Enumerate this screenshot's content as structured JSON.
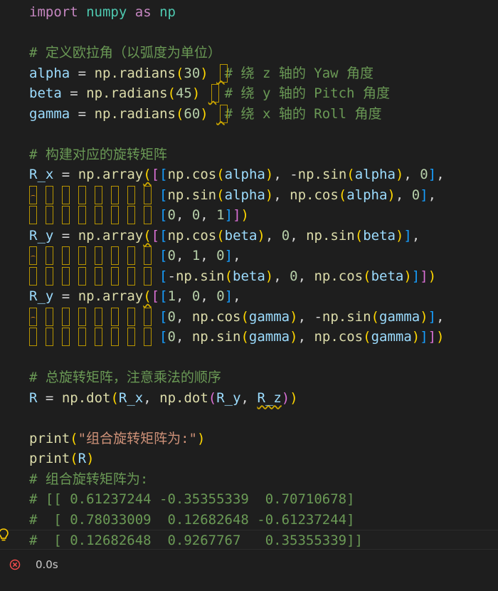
{
  "code": {
    "l1": [
      "import",
      "numpy",
      "as",
      "np"
    ],
    "l3": "# 定义欧拉角（以弧度为单位）",
    "l4": {
      "var": "alpha",
      "fn": "np.radians",
      "num": "30",
      "cmt": "# 绕 z 轴的 Yaw 角度"
    },
    "l5": {
      "var": "beta",
      "fn": "np.radians",
      "num": "45",
      "cmt": "# 绕 y 轴的 Pitch 角度"
    },
    "l6": {
      "var": "gamma",
      "fn": "np.radians",
      "num": "60",
      "cmt": "# 绕 x 轴的 Roll 角度"
    },
    "l8": "# 构建对应的旋转矩阵",
    "l22": "# 总旋转矩阵，注意乘法的顺序",
    "l25_str": "\"组合旋转矩阵为:\"",
    "l27": "# 组合旋转矩阵为:",
    "l28": "# [[ 0.61237244 -0.35355339  0.70710678]",
    "l29": "#  [ 0.78033009  0.12682648 -0.61237244]",
    "l30": "#  [ 0.12682648  0.9267767   0.35355339]]"
  },
  "status": {
    "time": "0.0s",
    "error_icon": "error-circle-icon"
  },
  "gutter": {
    "lightbulb_icon": "lightbulb-icon"
  },
  "colors": {
    "background": "#1e1e1e",
    "keyword": "#c586c0",
    "variable": "#9cdcfe",
    "function": "#dcdcaa",
    "number": "#b5cea8",
    "string": "#ce9178",
    "comment": "#6a9955",
    "bracket1": "#ffd700",
    "bracket2": "#da70d6",
    "bracket3": "#179fff"
  }
}
